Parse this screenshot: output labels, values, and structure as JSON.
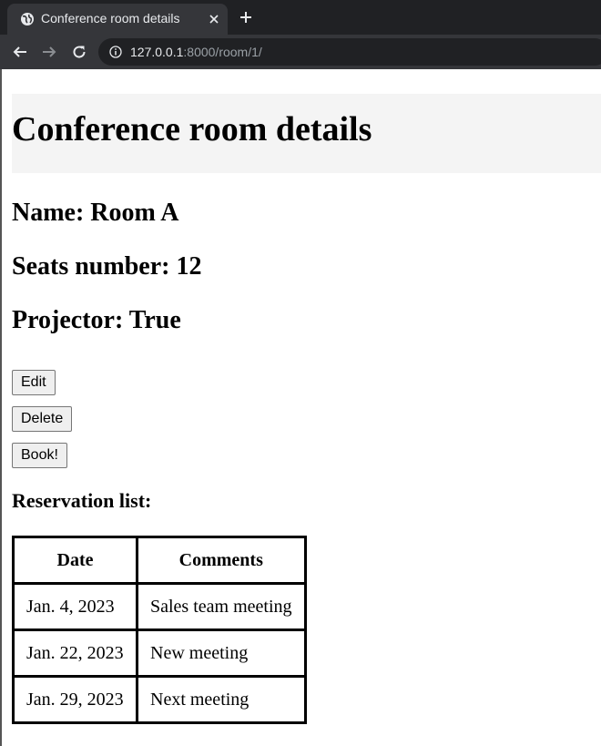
{
  "browser": {
    "tab_title": "Conference room details",
    "url_host": "127.0.0.1",
    "url_rest": ":8000/room/1/"
  },
  "page": {
    "title": "Conference room details",
    "name_line": "Name: Room A",
    "seats_line": "Seats number: 12",
    "projector_line": "Projector: True",
    "buttons": {
      "edit": "Edit",
      "delete": "Delete",
      "book": "Book!"
    },
    "reservations_heading": "Reservation list:",
    "table": {
      "headers": [
        "Date",
        "Comments"
      ],
      "rows": [
        [
          "Jan. 4, 2023",
          "Sales team meeting"
        ],
        [
          "Jan. 22, 2023",
          "New meeting"
        ],
        [
          "Jan. 29, 2023",
          "Next meeting"
        ]
      ]
    }
  },
  "colors": {
    "chrome_dark": "#202124",
    "chrome_tab": "#35363a",
    "header_band": "#f4f4f4"
  },
  "icons": [
    "globe-icon",
    "close-icon",
    "plus-icon",
    "back-arrow-icon",
    "forward-arrow-icon",
    "reload-icon",
    "info-icon"
  ]
}
